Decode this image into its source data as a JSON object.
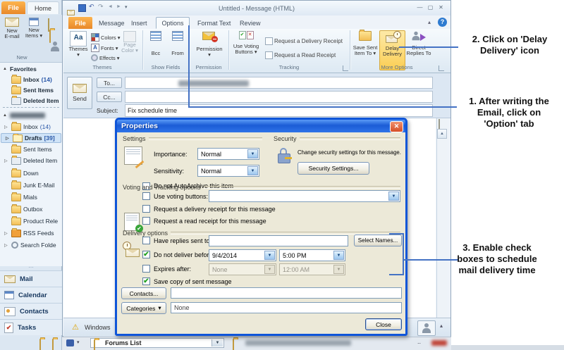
{
  "outlook": {
    "file_tab": "File",
    "home_tab": "Home",
    "new_email_l1": "New",
    "new_email_l2": "E-mail",
    "new_items_l1": "New",
    "new_items_l2": "Items",
    "new_group": "New",
    "favorites": "Favorites",
    "fav_inbox": "Inbox",
    "fav_inbox_count": "(14)",
    "fav_sent": "Sent Items",
    "fav_deleted": "Deleted Item",
    "inbox": "Inbox",
    "inbox_count": "(14)",
    "drafts": "Drafts",
    "drafts_count": "[39]",
    "sent": "Sent Items",
    "deleted": "Deleted Item",
    "down": "Down",
    "junk": "Junk E-Mail",
    "mials": "Mials",
    "outbox": "Outbox",
    "product": "Product Rele",
    "rss": "RSS Feeds",
    "search": "Search Folde",
    "nav_mail": "Mail",
    "nav_calendar": "Calendar",
    "nav_contacts": "Contacts",
    "nav_tasks": "Tasks",
    "forums_list": "Forums List"
  },
  "message": {
    "title": "Untitled - Message (HTML)",
    "tab_file": "File",
    "tab_message": "Message",
    "tab_insert": "Insert",
    "tab_options": "Options",
    "tab_format": "Format Text",
    "tab_review": "Review",
    "themes": "Themes",
    "colors": "Colors",
    "fonts": "Fonts",
    "effects": "Effects",
    "page_l1": "Page",
    "page_l2": "Color",
    "grp_themes": "Themes",
    "bcc": "Bcc",
    "from": "From",
    "grp_show_fields": "Show Fields",
    "permission": "Permission",
    "grp_permission": "Permission",
    "voting_l1": "Use Voting",
    "voting_l2": "Buttons",
    "req_delivery": "Request a Delivery Receipt",
    "req_read": "Request a Read Receipt",
    "grp_tracking": "Tracking",
    "save_sent_l1": "Save Sent",
    "save_sent_l2": "Item To",
    "delay_l1": "Delay",
    "delay_l2": "Delivery",
    "direct_l1": "Direct",
    "direct_l2": "Replies To",
    "grp_more": "More Options",
    "send": "Send",
    "to": "To...",
    "cc": "Cc...",
    "subject_label": "Subject:",
    "subject_value": "Fix schedule time",
    "status_left": "Windows"
  },
  "dialog": {
    "title": "Properties",
    "settings": "Settings",
    "importance": "Importance:",
    "importance_value": "Normal",
    "sensitivity": "Sensitivity:",
    "sensitivity_value": "Normal",
    "autoarchive": "Do not AutoArchive this item",
    "security": "Security",
    "security_text": "Change security settings for this message.",
    "security_button": "Security Settings...",
    "voting_header": "Voting and Tracking options",
    "use_voting": "Use voting buttons:",
    "req_delivery": "Request a delivery receipt for this message",
    "req_read": "Request a read receipt for this message",
    "delivery_header": "Delivery options",
    "have_replies": "Have replies sent to:",
    "select_names": "Select Names...",
    "no_deliver": "Do not deliver before:",
    "deliver_date": "9/4/2014",
    "deliver_time": "5:00 PM",
    "expires": "Expires after:",
    "expires_date": "None",
    "expires_time": "12:00 AM",
    "save_copy": "Save copy of sent message",
    "contacts": "Contacts...",
    "categories": "Categories",
    "categories_value": "None",
    "close": "Close"
  },
  "annotations": {
    "line_color": "#4472c4",
    "s1l1": "1. After writing the",
    "s1l2": "Email, click on",
    "s1l3": "'Option' tab",
    "s2l1": "2. Click on 'Delay",
    "s2l2": "Delivery' icon",
    "s3l1": "3. Enable check",
    "s3l2": "boxes to schedule",
    "s3l3": "mail delivery time"
  },
  "icons": {
    "dropdown_arrow": "▼",
    "small_arrow": "▾",
    "expander_open": "▲",
    "expander_closed": "▷",
    "warning": "⚠",
    "help": "?",
    "minimize": "—",
    "maximize": "▢",
    "close": "✕",
    "undo": "↶",
    "redo": "↷",
    "back": "◄",
    "forward": "►",
    "collapse": "▴",
    "scroll_up": "▲",
    "grip": "⋯",
    "check": "✔",
    "cross": "✕",
    "ellipsis": "..",
    "aa": "Aa",
    "a": "A"
  }
}
